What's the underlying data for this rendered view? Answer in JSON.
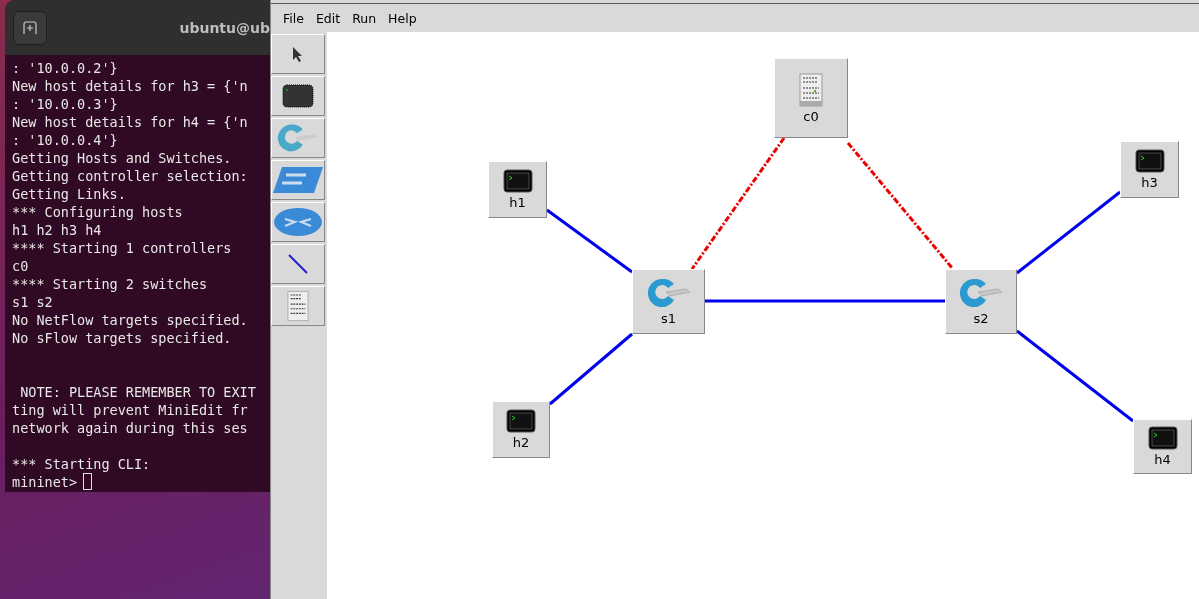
{
  "terminal": {
    "title": "ubuntu@ub",
    "blocks": [
      {
        "kind": "top",
        "lines": [
          ": '10.0.0.2'}",
          "New host details for h3 = {'n",
          ": '10.0.0.3'}",
          "New host details for h4 = {'n",
          ": '10.0.0.4'}",
          "Getting Hosts and Switches.",
          "Getting controller selection:",
          "Getting Links.",
          "*** Configuring hosts",
          "h1 h2 h3 h4",
          "**** Starting 1 controllers",
          "c0",
          "**** Starting 2 switches",
          "s1 s2",
          "No NetFlow targets specified.",
          "No sFlow targets specified."
        ]
      },
      {
        "kind": "widegap",
        "lines": [
          " NOTE: PLEASE REMEMBER TO EXIT",
          "ting will prevent MiniEdit fr",
          "network again during this ses"
        ]
      },
      {
        "kind": "gap",
        "lines": [
          "*** Starting CLI:"
        ]
      }
    ],
    "prompt": "mininet>"
  },
  "miniedit": {
    "menu": [
      "File",
      "Edit",
      "Run",
      "Help"
    ],
    "tools": [
      {
        "kind": "select"
      },
      {
        "kind": "host"
      },
      {
        "kind": "switch"
      },
      {
        "kind": "legacy-switch"
      },
      {
        "kind": "legacy-router"
      },
      {
        "kind": "link"
      },
      {
        "kind": "controller"
      }
    ],
    "nodes": [
      {
        "label": "c0",
        "kind": "controller"
      },
      {
        "label": "h1",
        "kind": "host"
      },
      {
        "label": "h3",
        "kind": "host"
      },
      {
        "label": "s1",
        "kind": "switch"
      },
      {
        "label": "s2",
        "kind": "switch"
      },
      {
        "label": "h2",
        "kind": "host"
      },
      {
        "label": "h4",
        "kind": "host"
      }
    ],
    "links": [
      {
        "kind": "data"
      },
      {
        "kind": "data"
      },
      {
        "kind": "data"
      },
      {
        "kind": "data"
      },
      {
        "kind": "data"
      },
      {
        "kind": "control"
      },
      {
        "kind": "control"
      }
    ]
  }
}
